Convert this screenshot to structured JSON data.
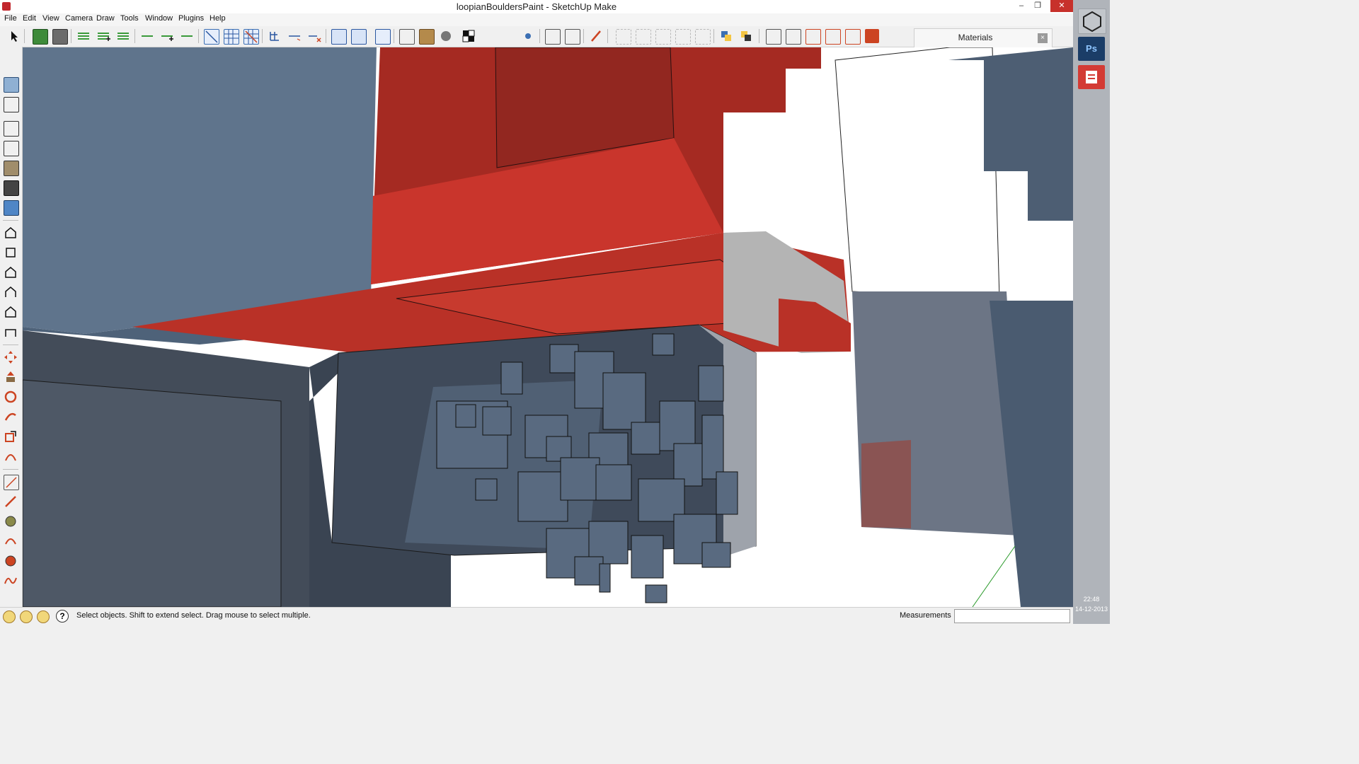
{
  "window": {
    "title": "loopianBouldersPaint - SketchUp Make",
    "minimize_glyph": "–",
    "restore_glyph": "❐",
    "close_glyph": "✕"
  },
  "menu": {
    "items": [
      "File",
      "Edit",
      "View",
      "Camera",
      "Draw",
      "Tools",
      "Window",
      "Plugins",
      "Help"
    ]
  },
  "materials_panel": {
    "title": "Materials",
    "close_glyph": "×"
  },
  "status": {
    "hint": "Select objects. Shift to extend select. Drag mouse to select multiple.",
    "help_glyph": "?",
    "measurements_label": "Measurements",
    "measurements_value": ""
  },
  "taskbar": {
    "apps": [
      "unity-icon",
      "photoshop-icon",
      "sketchup-icon"
    ],
    "photoshop_label": "Ps",
    "time": "22:48",
    "date": "14-12-2013"
  },
  "colors": {
    "accent_red": "#c9352c",
    "slate_blue": "#5e7187",
    "dark_slate": "#3f4a5a",
    "taskbar": "#b0b4ba"
  }
}
